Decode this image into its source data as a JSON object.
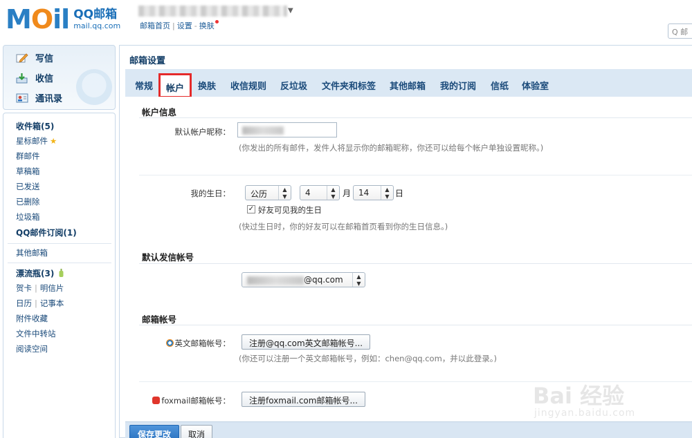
{
  "header": {
    "logo_mail": "MOil",
    "logo_title": "QQ邮箱",
    "logo_domain": "mail.qq.com",
    "links": [
      "邮箱首页",
      "设置",
      "换肤"
    ],
    "search_placeholder": "Q 邮"
  },
  "sidebar": {
    "compose": [
      {
        "label": "写信",
        "icon": "compose-pencil-icon"
      },
      {
        "label": "收信",
        "icon": "inbox-download-icon"
      },
      {
        "label": "通讯录",
        "icon": "contacts-card-icon"
      }
    ],
    "folders": [
      {
        "label": "收件箱(5)",
        "bold": true
      },
      {
        "label": "星标邮件",
        "star": "★"
      },
      {
        "label": "群邮件"
      },
      {
        "label": "草稿箱"
      },
      {
        "label": "已发送"
      },
      {
        "label": "已删除"
      },
      {
        "label": "垃圾箱"
      },
      {
        "label": "QQ邮件订阅(1)",
        "bold": true
      }
    ],
    "other_mailbox": "其他邮箱",
    "apps": {
      "drift_bottle": "漂流瓶(3)",
      "greeting_card": "贺卡",
      "postcard": "明信片",
      "calendar": "日历",
      "notepad": "记事本",
      "attachments": "附件收藏",
      "file_transfer": "文件中转站",
      "reading_space": "阅读空间",
      "separator": "|"
    }
  },
  "main": {
    "title": "邮箱设置",
    "tabs": [
      "常规",
      "帐户",
      "换肤",
      "收信规则",
      "反垃圾",
      "文件夹和标签",
      "其他邮箱",
      "我的订阅",
      "信纸",
      "体验室"
    ],
    "active_tab": "帐户",
    "account_info": {
      "section_title": "帐户信息",
      "nickname_label": "默认帐户昵称：",
      "nickname_hint": "(你发出的所有邮件，发件人将显示你的邮箱昵称，你还可以给每个帐户单独设置昵称。)"
    },
    "birthday": {
      "label": "我的生日：",
      "calendar_type": "公历",
      "month": "4",
      "month_unit": "月",
      "day": "14",
      "day_unit": "日",
      "checkbox_label": "好友可见我的生日",
      "checkbox_checked": true,
      "hint": "(快过生日时，你的好友可以在邮箱首页看到你的生日信息。)"
    },
    "default_sender": {
      "section_title": "默认发信帐号",
      "address_suffix": "@qq.com"
    },
    "mail_accounts": {
      "section_title": "邮箱帐号",
      "english_label": "英文邮箱帐号：",
      "english_button": "注册@qq.com英文邮箱帐号...",
      "english_hint": "(你还可以注册一个英文邮箱帐号，例如：chen@qq.com，并以此登录。)",
      "foxmail_label": "foxmail邮箱帐号：",
      "foxmail_button": "注册foxmail.com邮箱帐号..."
    },
    "save_button": "保存更改",
    "cancel_button": "取消"
  },
  "watermark": {
    "brand": "Bai 经验",
    "url": "jingyan.baidu.com"
  },
  "colors": {
    "accent_blue": "#2a72c0",
    "tab_bar": "#dbe8f4",
    "active_tab_outline": "#e52a2a",
    "link_blue": "#1a4a7a"
  }
}
